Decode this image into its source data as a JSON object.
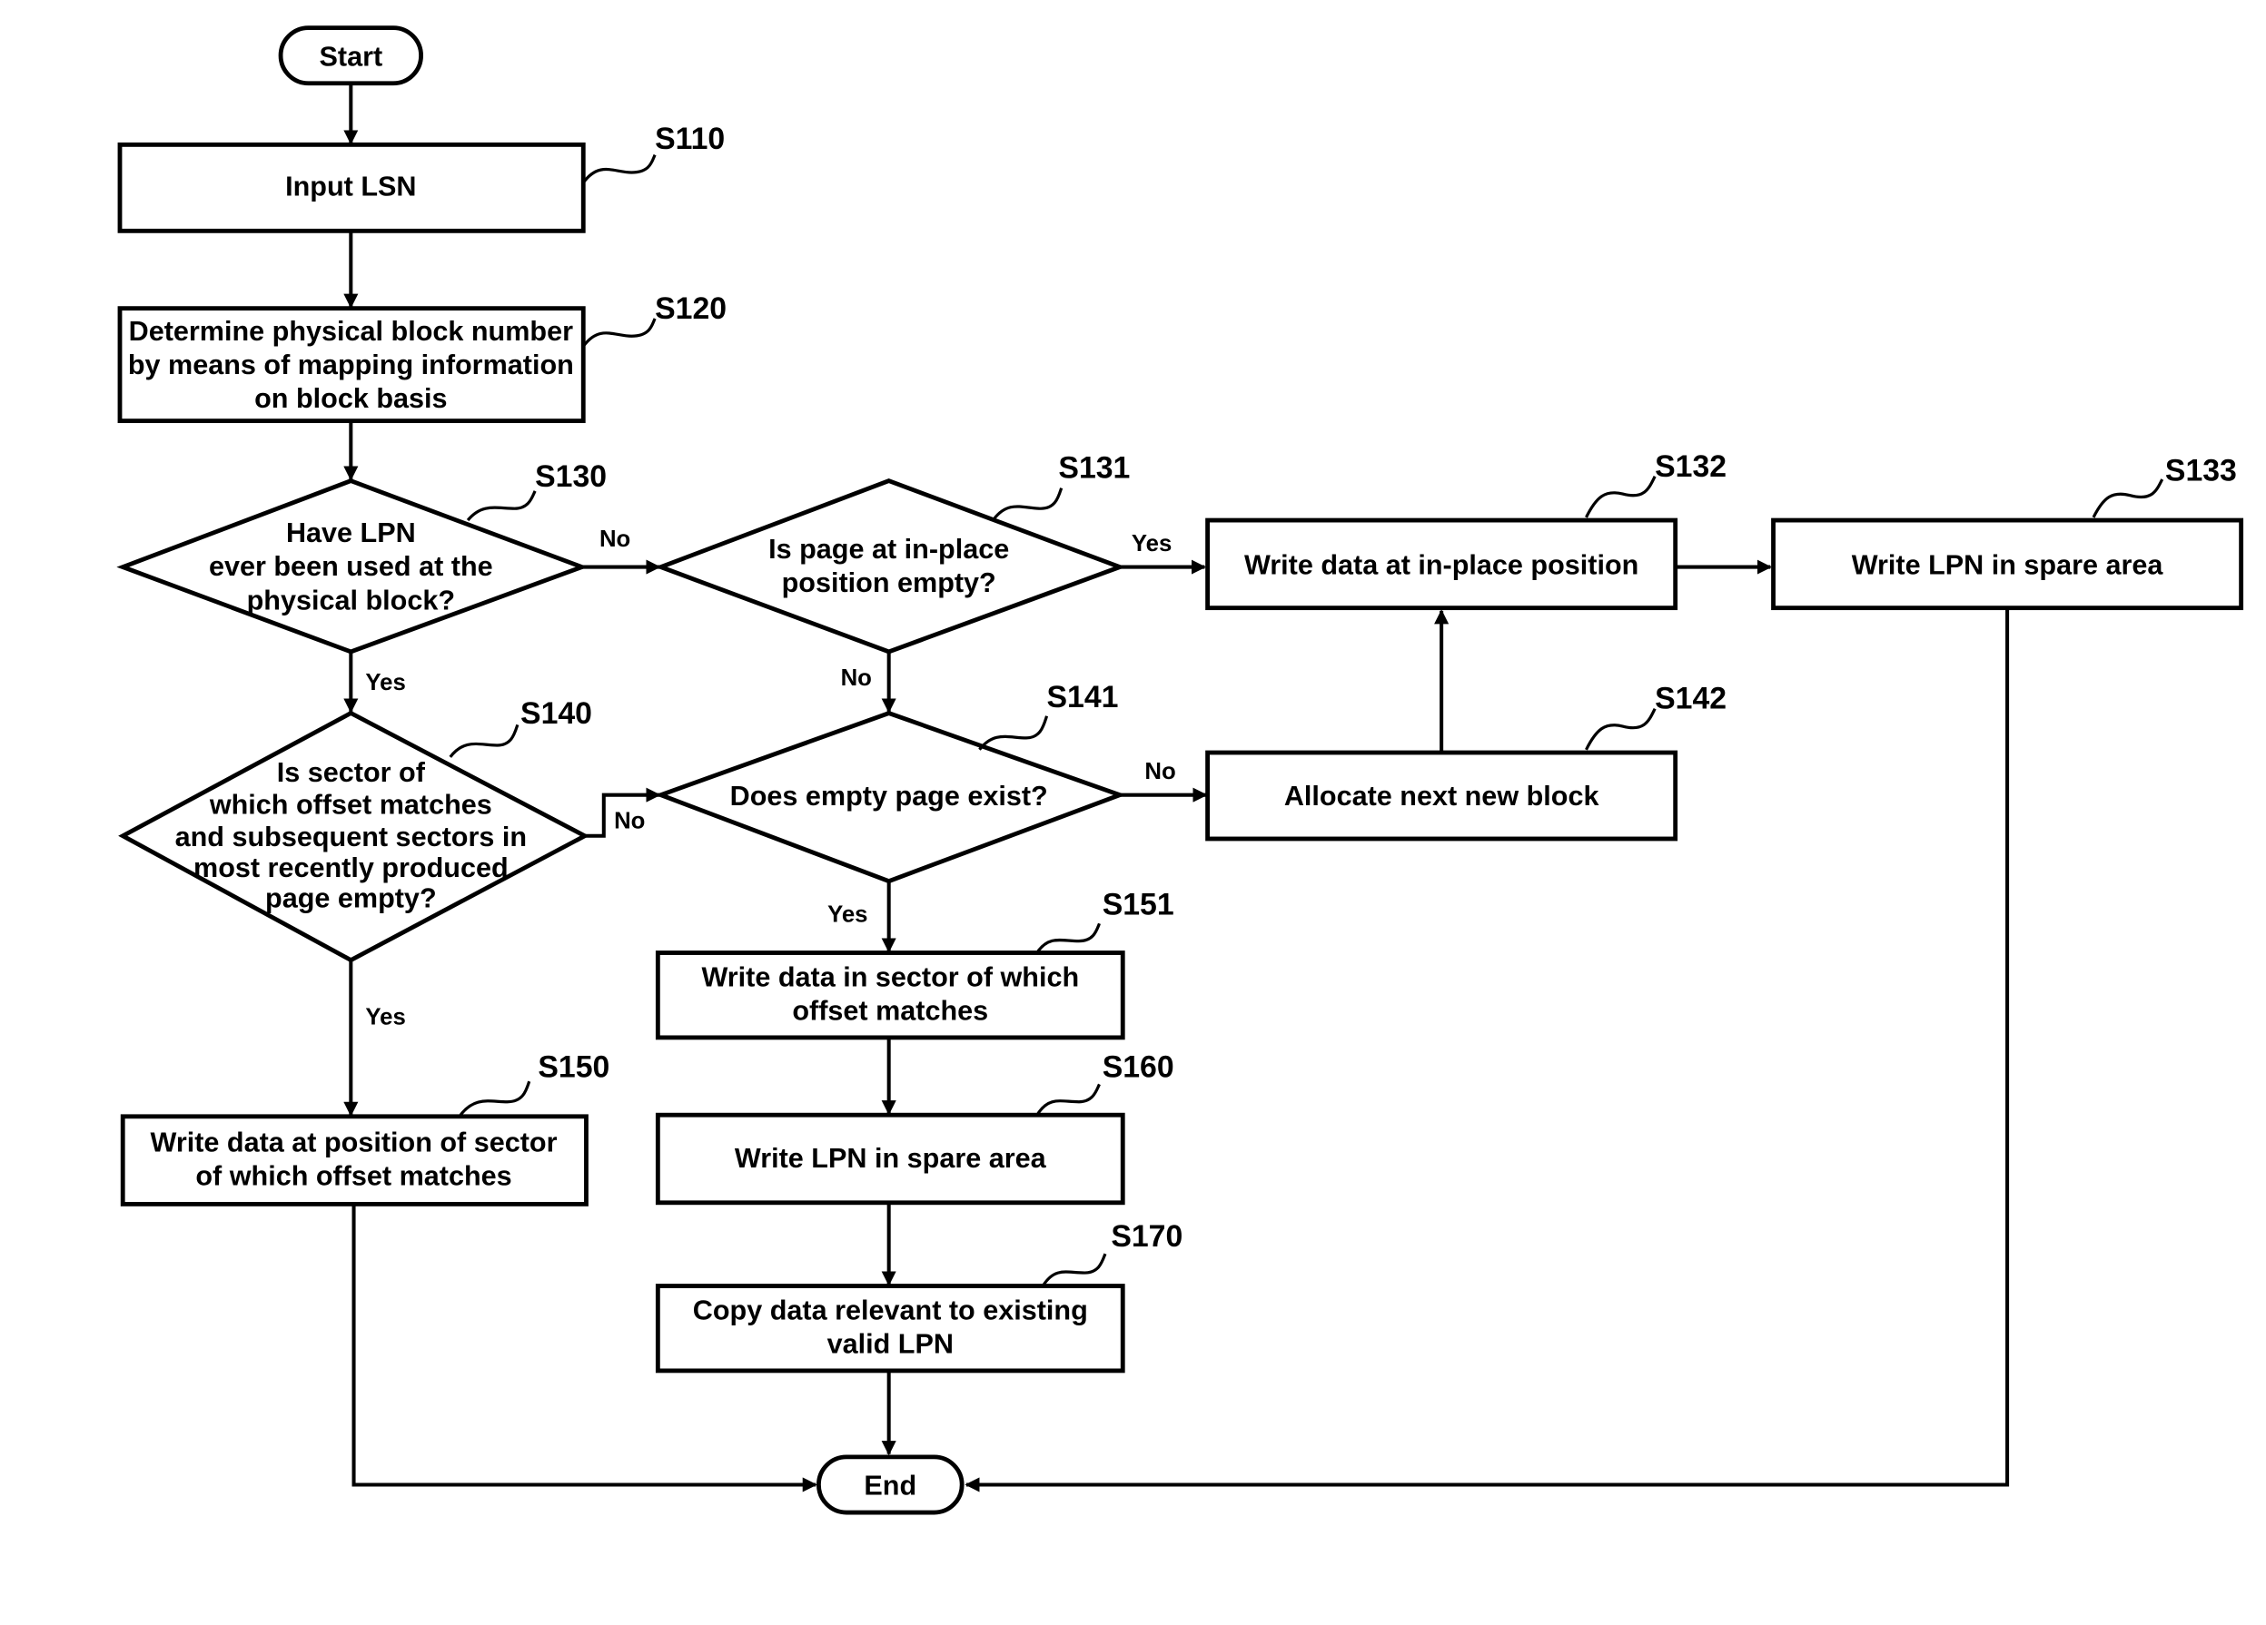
{
  "flowchart": {
    "start": "Start",
    "end": "End",
    "steps": {
      "s110": {
        "ref": "S110",
        "lines": [
          "Input LSN"
        ]
      },
      "s120": {
        "ref": "S120",
        "lines": [
          "Determine physical block number",
          "by means of mapping information",
          "on block basis"
        ]
      },
      "s130": {
        "ref": "S130",
        "lines": [
          "Have LPN",
          "ever been used at the",
          "physical block?"
        ]
      },
      "s131": {
        "ref": "S131",
        "lines": [
          "Is page at in-place",
          "position empty?"
        ]
      },
      "s132": {
        "ref": "S132",
        "lines": [
          "Write data at in-place position"
        ]
      },
      "s133": {
        "ref": "S133",
        "lines": [
          "Write LPN in spare area"
        ]
      },
      "s140": {
        "ref": "S140",
        "lines": [
          "Is sector of",
          "which offset matches",
          "and subsequent sectors in",
          "most recently produced",
          "page empty?"
        ]
      },
      "s141": {
        "ref": "S141",
        "lines": [
          "Does empty page exist?"
        ]
      },
      "s142": {
        "ref": "S142",
        "lines": [
          "Allocate next new block"
        ]
      },
      "s150": {
        "ref": "S150",
        "lines": [
          "Write data at position of sector",
          "of which offset matches"
        ]
      },
      "s151": {
        "ref": "S151",
        "lines": [
          "Write data in sector of which",
          "offset matches"
        ]
      },
      "s160": {
        "ref": "S160",
        "lines": [
          "Write LPN in spare area"
        ]
      },
      "s170": {
        "ref": "S170",
        "lines": [
          "Copy data relevant to existing",
          "valid LPN"
        ]
      }
    },
    "branch_labels": {
      "s130_no": "No",
      "s130_yes": "Yes",
      "s131_yes": "Yes",
      "s131_no": "No",
      "s140_no": "No",
      "s140_yes": "Yes",
      "s141_no": "No",
      "s141_yes": "Yes"
    }
  }
}
